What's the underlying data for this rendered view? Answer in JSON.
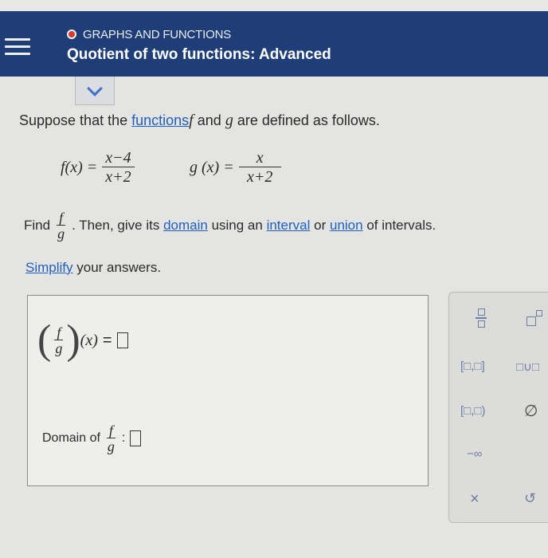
{
  "header": {
    "topic": "GRAPHS AND FUNCTIONS",
    "lesson_title": "Quotient of two functions: Advanced",
    "accent_color": "#1f3e78",
    "topic_dot_color": "#d63a2b"
  },
  "problem": {
    "intro_before": "Suppose that the",
    "intro_link": "functions",
    "intro_f": "f",
    "intro_and": "and",
    "intro_g": "g",
    "intro_after": "are defined as follows.",
    "f_label": "f(x) =",
    "f_num": "x−4",
    "f_den": "x+2",
    "g_label": "g (x) =",
    "g_num": "x",
    "g_den": "x+2",
    "find_word": "Find",
    "find_num": "f",
    "find_den": "g",
    "find_then": ". Then, give its",
    "link_domain": "domain",
    "using": "using an",
    "link_interval": "interval",
    "or_word": "or",
    "link_union": "union",
    "of_intervals": "of intervals.",
    "link_simplify": "Simplify",
    "your_answers": "your answers."
  },
  "answer": {
    "expr_num": "f",
    "expr_den": "g",
    "expr_arg": "(x)",
    "equals": "=",
    "domain_label": "Domain of",
    "domain_num": "f",
    "domain_den": "g",
    "colon": ":"
  },
  "palette": {
    "closed_interval": "[□,□]",
    "union_symbol": "□∪□",
    "half_open_interval": "[□,□)",
    "empty_set": "∅",
    "neg_infinity": "−∞",
    "clear": "×",
    "undo": "↺"
  }
}
